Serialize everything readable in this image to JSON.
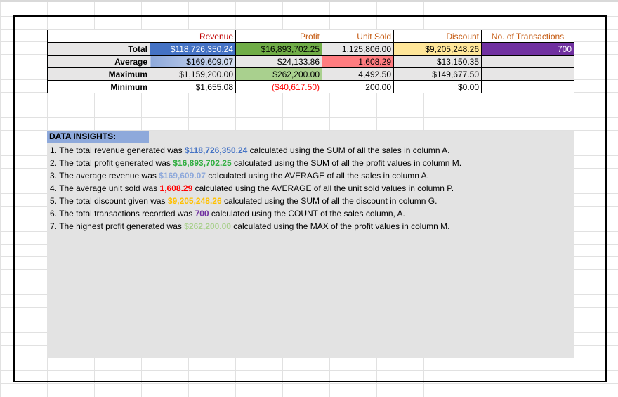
{
  "table": {
    "headers": {
      "revenue": "Revenue",
      "profit": "Profit",
      "unit_sold": "Unit Sold",
      "discount": "Discount",
      "transactions": "No. of Transactions"
    },
    "rows": {
      "total": {
        "label": "Total",
        "revenue": "$118,726,350.24",
        "profit": "$16,893,702.25",
        "unit_sold": "1,125,806.00",
        "discount": "$9,205,248.26",
        "transactions": "700"
      },
      "average": {
        "label": "Average",
        "revenue": "$169,609.07",
        "profit": "$24,133.86",
        "unit_sold": "1,608.29",
        "discount": "$13,150.35",
        "transactions": ""
      },
      "maximum": {
        "label": "Maximum",
        "revenue": "$1,159,200.00",
        "profit": "$262,200.00",
        "unit_sold": "4,492.50",
        "discount": "$149,677.50",
        "transactions": ""
      },
      "minimum": {
        "label": "Minimum",
        "revenue": "$1,655.08",
        "profit": "($40,617.50)",
        "unit_sold": "200.00",
        "discount": "$0.00",
        "transactions": ""
      }
    }
  },
  "insights": {
    "title": "DATA INSIGHTS:",
    "lines": [
      {
        "pre": "1. The total revenue generated was ",
        "value": "$118,726,350.24",
        "post": " calculated using the SUM of all the sales in column A."
      },
      {
        "pre": "2. The total profit generated was ",
        "value": "$16,893,702.25",
        "post": " calculated using the SUM of all the profit values in column M."
      },
      {
        "pre": "3. The average revenue was ",
        "value": "$169,609.07",
        "post": " calculated using the AVERAGE of all the sales in column A."
      },
      {
        "pre": "4. The average unit sold was ",
        "value": "1,608.29",
        "post": " calculated using the AVERAGE of all the unit sold values in column P."
      },
      {
        "pre": "5. The total discount given was ",
        "value": "$9,205,248.26",
        "post": " calculated using the SUM of all the discount in column G."
      },
      {
        "pre": "6. The total transactions recorded was ",
        "value": "700",
        "post": " calculated using the COUNT of the sales column, A."
      },
      {
        "pre": "7. The highest profit generated was ",
        "value": "$262,200.00",
        "post": " calculated using the MAX of the profit values in column M."
      }
    ]
  },
  "colors": {
    "revenue_total": "#4472c4",
    "profit_total": "#70ad47",
    "unit_avg": "#ff7c80",
    "discount_total": "#ffe699",
    "transactions_total": "#7030a0",
    "insights_bg": "#e3e3e3",
    "insights_title_bg": "#8ea9db"
  }
}
